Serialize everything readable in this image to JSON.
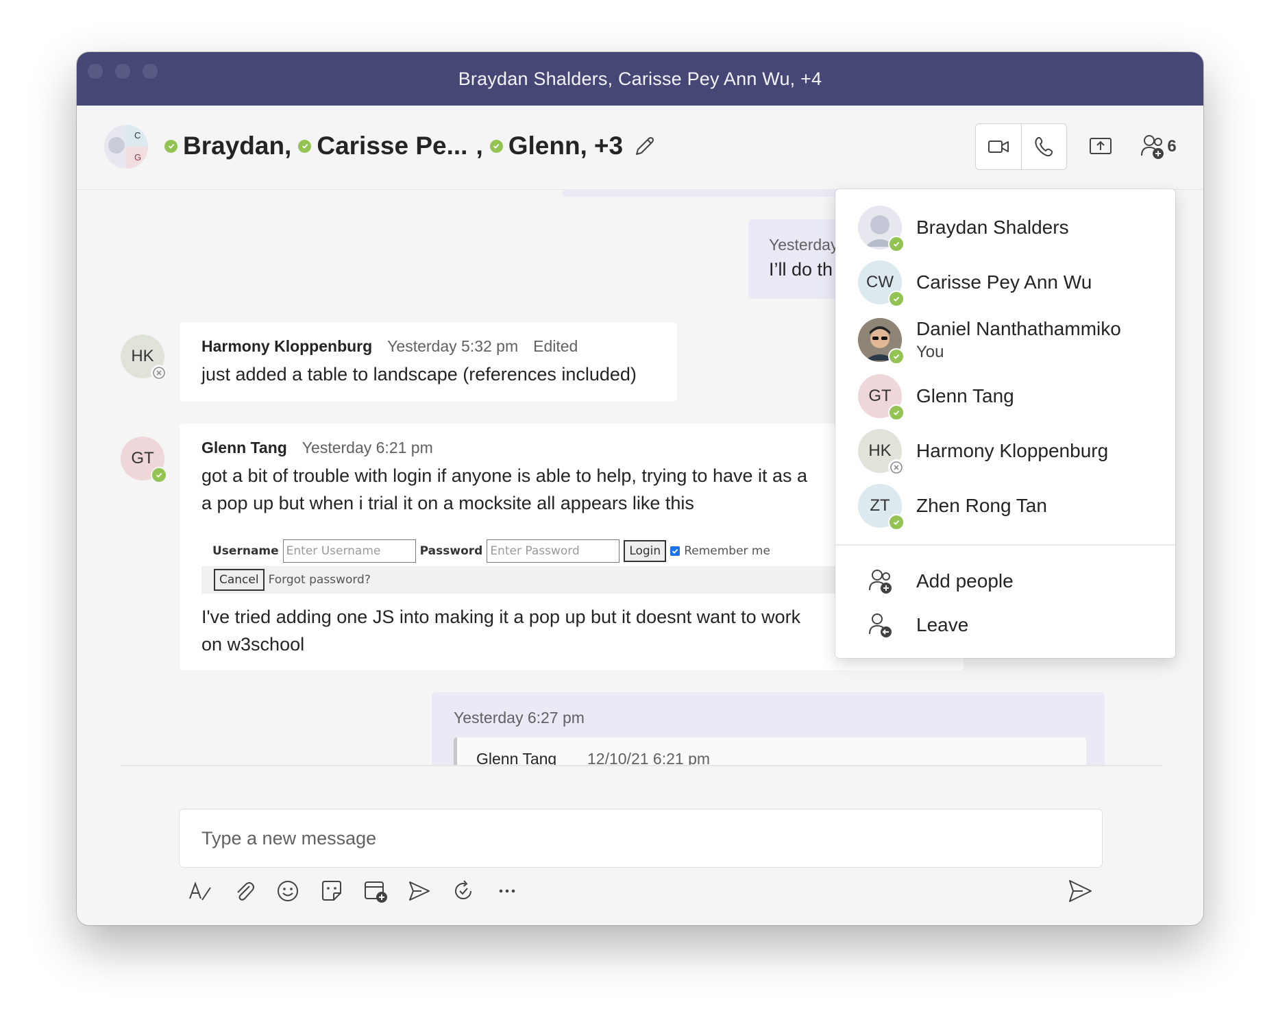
{
  "window": {
    "title": "Braydan Shalders, Carisse Pey Ann Wu, +4"
  },
  "header": {
    "participants": [
      "Braydan,",
      "Carisse Pe...",
      ",",
      "Glenn,",
      "+3"
    ],
    "people_count": "6",
    "group_avatar_letters": [
      "C",
      "G"
    ]
  },
  "messages": {
    "top_mine": {
      "time": "Yesterday",
      "text": "I’ll do th"
    },
    "hk": {
      "initials": "HK",
      "name": "Harmony Kloppenburg",
      "time": "Yesterday 5:32 pm",
      "edited": "Edited",
      "text": "just added a table to landscape (references included)"
    },
    "gt": {
      "initials": "GT",
      "name": "Glenn Tang",
      "time": "Yesterday 6:21 pm",
      "text1": "got a bit of trouble with login if anyone is able to help, trying to have it as a",
      "text2": "a pop up but when i trial it on a mocksite all appears like this",
      "text3": "I've tried adding one JS into making it a pop up but it doesnt want to work",
      "text4": "on w3school",
      "snippet": {
        "username_label": "Username",
        "username_placeholder": "Enter Username",
        "password_label": "Password",
        "password_placeholder": "Enter Password",
        "login": "Login",
        "remember": "Remember me",
        "cancel": "Cancel",
        "forgot": "Forgot password?"
      }
    },
    "bottom_mine": {
      "time": "Yesterday 6:27 pm",
      "quote_name": "Glenn Tang",
      "quote_time": "12/10/21 6:21 pm"
    }
  },
  "composer": {
    "placeholder": "Type a new message"
  },
  "people_popup": {
    "members": [
      {
        "initials": "",
        "name": "Braydan Shalders",
        "sub": "",
        "status": "available"
      },
      {
        "initials": "CW",
        "name": "Carisse Pey Ann Wu",
        "sub": "",
        "status": "available"
      },
      {
        "initials": "",
        "name": "Daniel Nanthathammiko",
        "sub": "You",
        "status": "available"
      },
      {
        "initials": "GT",
        "name": "Glenn Tang",
        "sub": "",
        "status": "available"
      },
      {
        "initials": "HK",
        "name": "Harmony Kloppenburg",
        "sub": "",
        "status": "offline"
      },
      {
        "initials": "ZT",
        "name": "Zhen Rong Tan",
        "sub": "",
        "status": "available"
      }
    ],
    "actions": [
      "Add people",
      "Leave"
    ]
  },
  "colors": {
    "titlebar": "#464775",
    "available": "#92c353",
    "mine_bubble": "#e9eaf6"
  }
}
